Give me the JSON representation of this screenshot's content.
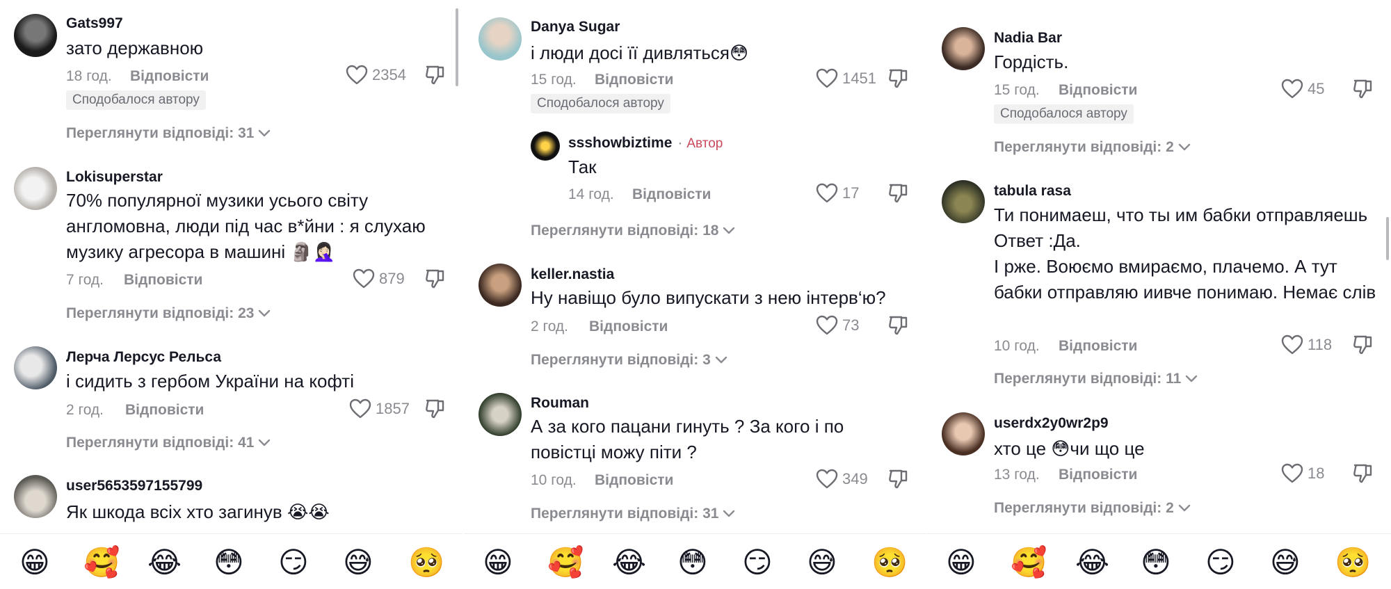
{
  "panels": [
    {
      "comments": [
        {
          "username": "Gats997",
          "text": "зато державною",
          "time": "18 год.",
          "reply": "Відповісти",
          "likes": "2354",
          "badge": "Сподобалося автору",
          "view_replies": "Переглянути відповіді: 31"
        },
        {
          "username": "Lokisuperstar",
          "text": "70% популярної музики усього світу англомовна, люди під час в*йни : я слухаю музику агресора в машині 🗿🤦🏻‍♀️",
          "time": "7 год.",
          "reply": "Відповісти",
          "likes": "879",
          "view_replies": "Переглянути відповіді: 23"
        },
        {
          "username": "Лерча Лерсус Рельса",
          "text": "і сидить з гербом України на кофті",
          "time": "2 год.",
          "reply": "Відповісти",
          "likes": "1857",
          "view_replies": "Переглянути відповіді: 41"
        },
        {
          "username": "user5653597155799",
          "text": "Як шкода всіх хто загинув 😭😭"
        }
      ],
      "emojis": [
        "😁",
        "🥰",
        "😂",
        "😳",
        "😏",
        "😅",
        "🥺"
      ]
    },
    {
      "comments": [
        {
          "username": "Danya Sugar",
          "text": "і люди досі її дивляться😳",
          "time": "15 год.",
          "reply": "Відповісти",
          "likes": "1451",
          "badge": "Сподобалося автору"
        },
        {
          "username": "ssshowbiztime",
          "author_label": "Автор",
          "text": "Так",
          "time": "14 год.",
          "reply": "Відповісти",
          "likes": "17",
          "view_replies": "Переглянути відповіді: 18"
        },
        {
          "username": "keller.nastia",
          "text": "Ну навіщо було випускати з нею інтерв‘ю?",
          "time": "2 год.",
          "reply": "Відповісти",
          "likes": "73",
          "view_replies": "Переглянути відповіді: 3"
        },
        {
          "username": "Rouman",
          "text": "А за кого пацани гинуть ? За кого і по повістці можу піти ?",
          "time": "10 год.",
          "reply": "Відповісти",
          "likes": "349",
          "view_replies": "Переглянути відповіді: 31"
        }
      ],
      "emojis": [
        "😁",
        "🥰",
        "😂",
        "😳",
        "😏",
        "😅",
        "🥺"
      ]
    },
    {
      "comments": [
        {
          "username": "Nadia Bar",
          "text": "Гордість.",
          "time": "15 год.",
          "reply": "Відповісти",
          "likes": "45",
          "badge": "Сподобалося автору",
          "view_replies": "Переглянути відповіді: 2"
        },
        {
          "username": "tabula rasa",
          "text": "Ти понимаеш, что ты им бабки отправляешь Ответ :Да.\nІ рже. Воюємо вмираємо, плачемо. А тут бабки отправляю иивче понимаю. Немає слів",
          "time": "10 год.",
          "reply": "Відповісти",
          "likes": "118",
          "view_replies": "Переглянути відповіді: 11"
        },
        {
          "username": "userdx2y0wr2p9",
          "text": "хто це 😳чи що це",
          "time": "13 год.",
          "reply": "Відповісти",
          "likes": "18",
          "view_replies": "Переглянути відповіді: 2"
        }
      ],
      "emojis": [
        "😁",
        "🥰",
        "😂",
        "😳",
        "😏",
        "😅",
        "🥺"
      ]
    }
  ]
}
